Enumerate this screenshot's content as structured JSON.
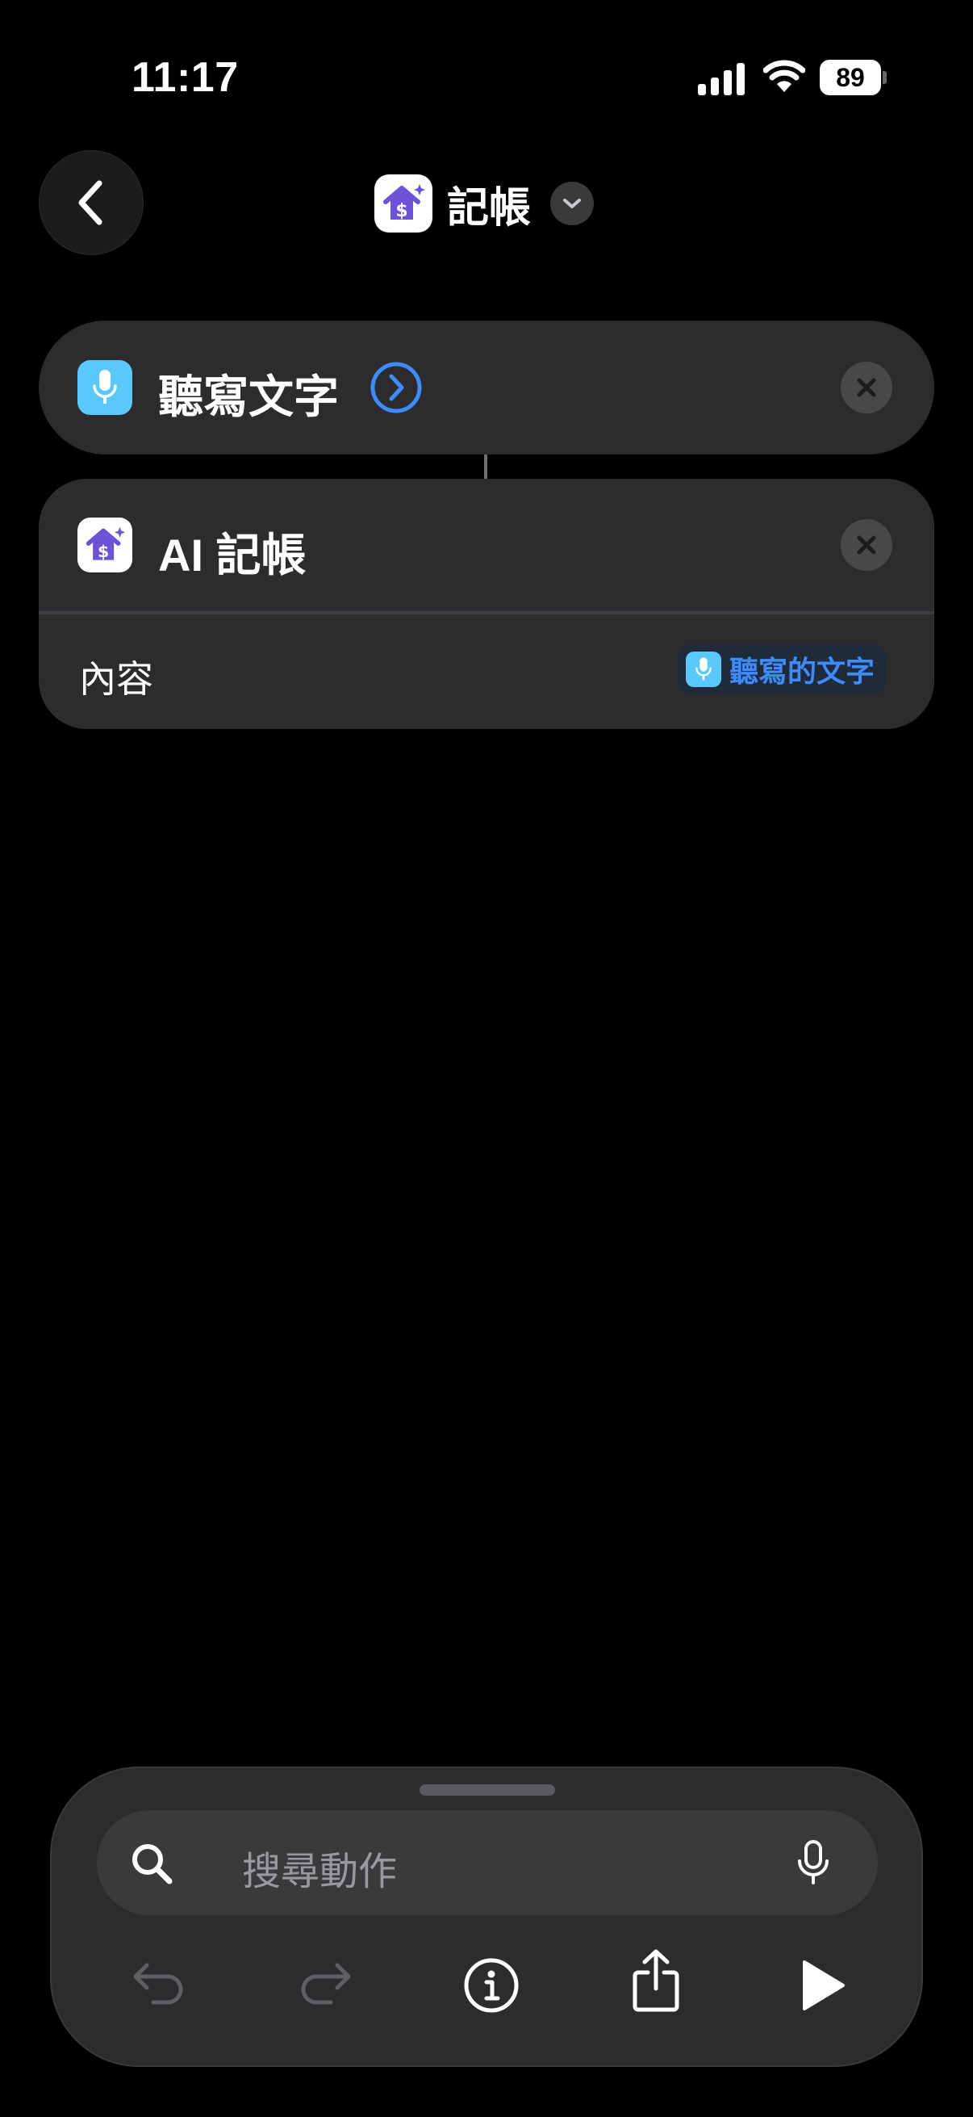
{
  "status_bar": {
    "time": "11:17",
    "battery": "89"
  },
  "header": {
    "title": "記帳",
    "back_icon": "chevron-left-icon",
    "app_icon": "house-dollar-icon"
  },
  "actions": [
    {
      "label": "聽寫文字",
      "icon": "microphone-icon",
      "icon_color": "#5ac8fa"
    },
    {
      "label": "AI 記帳",
      "icon": "house-dollar-icon",
      "parameter_label": "內容",
      "parameter_value": "聽寫的文字"
    }
  ],
  "search": {
    "placeholder": "搜尋動作"
  },
  "toolbar": [
    "undo-icon",
    "redo-icon",
    "info-icon",
    "share-icon",
    "play-icon"
  ],
  "colors": {
    "background": "#000000",
    "card": "#2c2c2e",
    "accent_blue": "#3d8bff",
    "app_purple": "#6b52d6"
  }
}
